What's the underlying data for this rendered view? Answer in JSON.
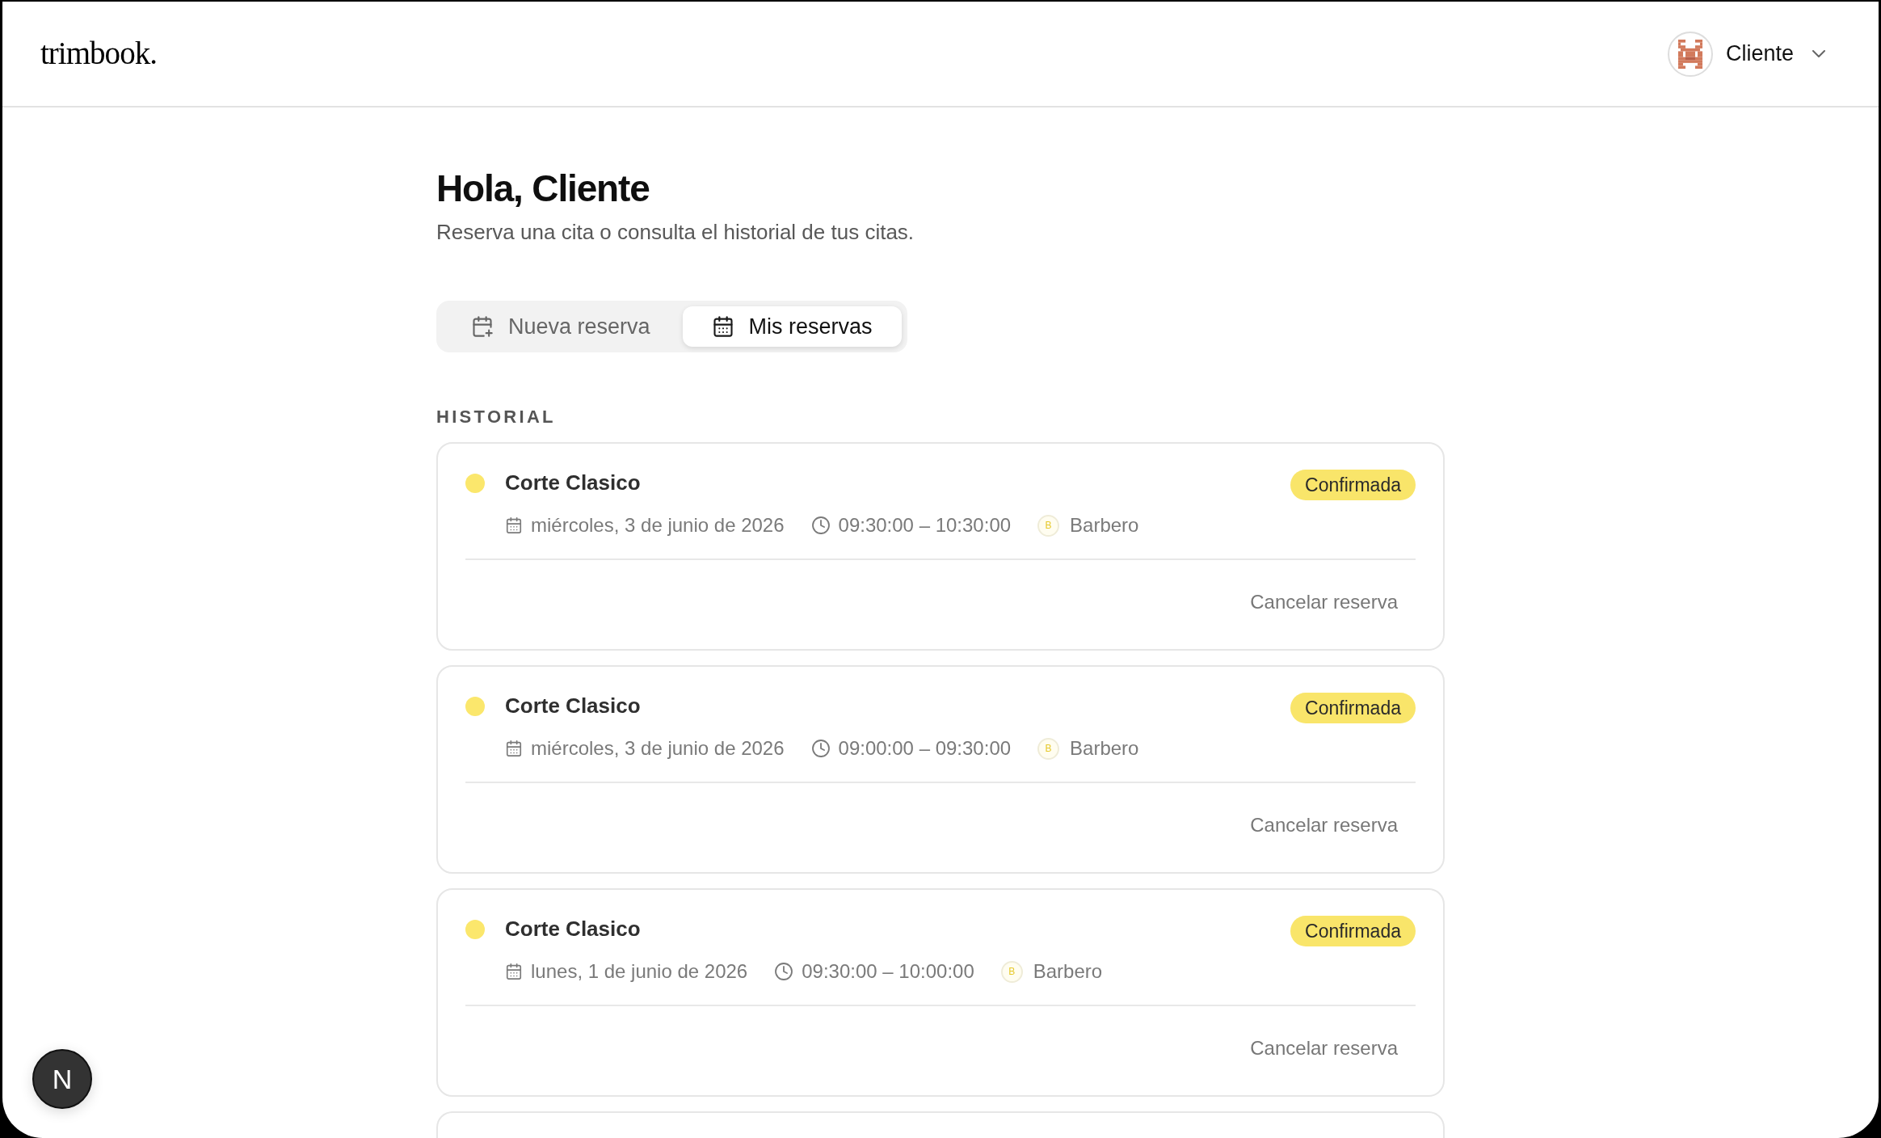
{
  "header": {
    "logo": "trimbook.",
    "user": {
      "name": "Cliente"
    }
  },
  "greeting": {
    "title": "Hola, Cliente",
    "subtitle": "Reserva una cita o consulta el historial de tus citas."
  },
  "tabs": [
    {
      "label": "Nueva reserva",
      "kind": "new",
      "selected": false
    },
    {
      "label": "Mis reservas",
      "kind": "list",
      "selected": true
    }
  ],
  "history": {
    "heading": "HISTORIAL",
    "appointments": [
      {
        "service": "Corte Clasico",
        "color": "#fbe76c",
        "status": {
          "label": "Confirmada",
          "kind": "confirmed"
        },
        "date": "miércoles, 3 de junio de 2026",
        "time": "09:30:00 – 10:30:00",
        "barber": {
          "initial": "B",
          "name": "Barbero"
        },
        "action": "Cancelar reserva"
      },
      {
        "service": "Corte Clasico",
        "color": "#fbe76c",
        "status": {
          "label": "Confirmada",
          "kind": "confirmed"
        },
        "date": "miércoles, 3 de junio de 2026",
        "time": "09:00:00 – 09:30:00",
        "barber": {
          "initial": "B",
          "name": "Barbero"
        },
        "action": "Cancelar reserva"
      },
      {
        "service": "Corte Clasico",
        "color": "#fbe76c",
        "status": {
          "label": "Confirmada",
          "kind": "confirmed"
        },
        "date": "lunes, 1 de junio de 2026",
        "time": "09:30:00 – 10:00:00",
        "barber": {
          "initial": "B",
          "name": "Barbero"
        },
        "action": "Cancelar reserva"
      }
    ]
  },
  "dev_tools": {
    "label": "N"
  }
}
